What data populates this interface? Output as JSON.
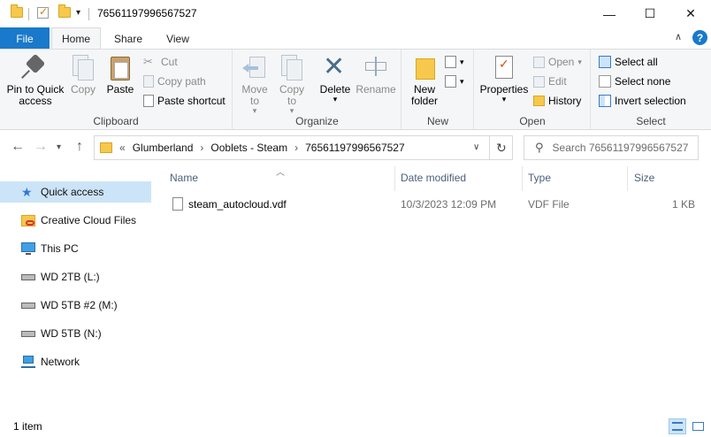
{
  "window": {
    "title": "76561197996567527",
    "minimize": "—",
    "maximize": "☐",
    "close": "✕"
  },
  "ribbon_tabs": {
    "file": "File",
    "home": "Home",
    "share": "Share",
    "view": "View"
  },
  "clipboard": {
    "pin": "Pin to Quick access",
    "copy": "Copy",
    "paste": "Paste",
    "cut": "Cut",
    "copy_path": "Copy path",
    "paste_shortcut": "Paste shortcut",
    "label": "Clipboard"
  },
  "organize": {
    "move_to": "Move to",
    "copy_to": "Copy to",
    "delete": "Delete",
    "rename": "Rename",
    "label": "Organize"
  },
  "new": {
    "new_folder": "New folder",
    "label": "New"
  },
  "open": {
    "properties": "Properties",
    "open": "Open",
    "edit": "Edit",
    "history": "History",
    "label": "Open"
  },
  "select": {
    "select_all": "Select all",
    "select_none": "Select none",
    "invert": "Invert selection",
    "label": "Select"
  },
  "address": {
    "crumbs": [
      "Glumberland",
      "Ooblets - Steam",
      "76561197996567527"
    ],
    "search_placeholder": "Search 76561197996567527"
  },
  "nav_pane": [
    {
      "label": "Quick access",
      "icon": "star-icon"
    },
    {
      "label": "Creative Cloud Files",
      "icon": "creative-cloud-icon"
    },
    {
      "label": "This PC",
      "icon": "pc-icon"
    },
    {
      "label": "WD 2TB (L:)",
      "icon": "drive-icon"
    },
    {
      "label": "WD 5TB #2 (M:)",
      "icon": "drive-icon"
    },
    {
      "label": "WD 5TB (N:)",
      "icon": "drive-icon"
    },
    {
      "label": "Network",
      "icon": "network-icon"
    }
  ],
  "columns": {
    "name": "Name",
    "date": "Date modified",
    "type": "Type",
    "size": "Size"
  },
  "files": [
    {
      "name": "steam_autocloud.vdf",
      "date": "10/3/2023 12:09 PM",
      "type": "VDF File",
      "size": "1 KB"
    }
  ],
  "status": {
    "count": "1 item"
  },
  "colors": {
    "accent": "#1979ca",
    "selected": "#cce4f7",
    "ribbon_bg": "#f5f6f7"
  }
}
